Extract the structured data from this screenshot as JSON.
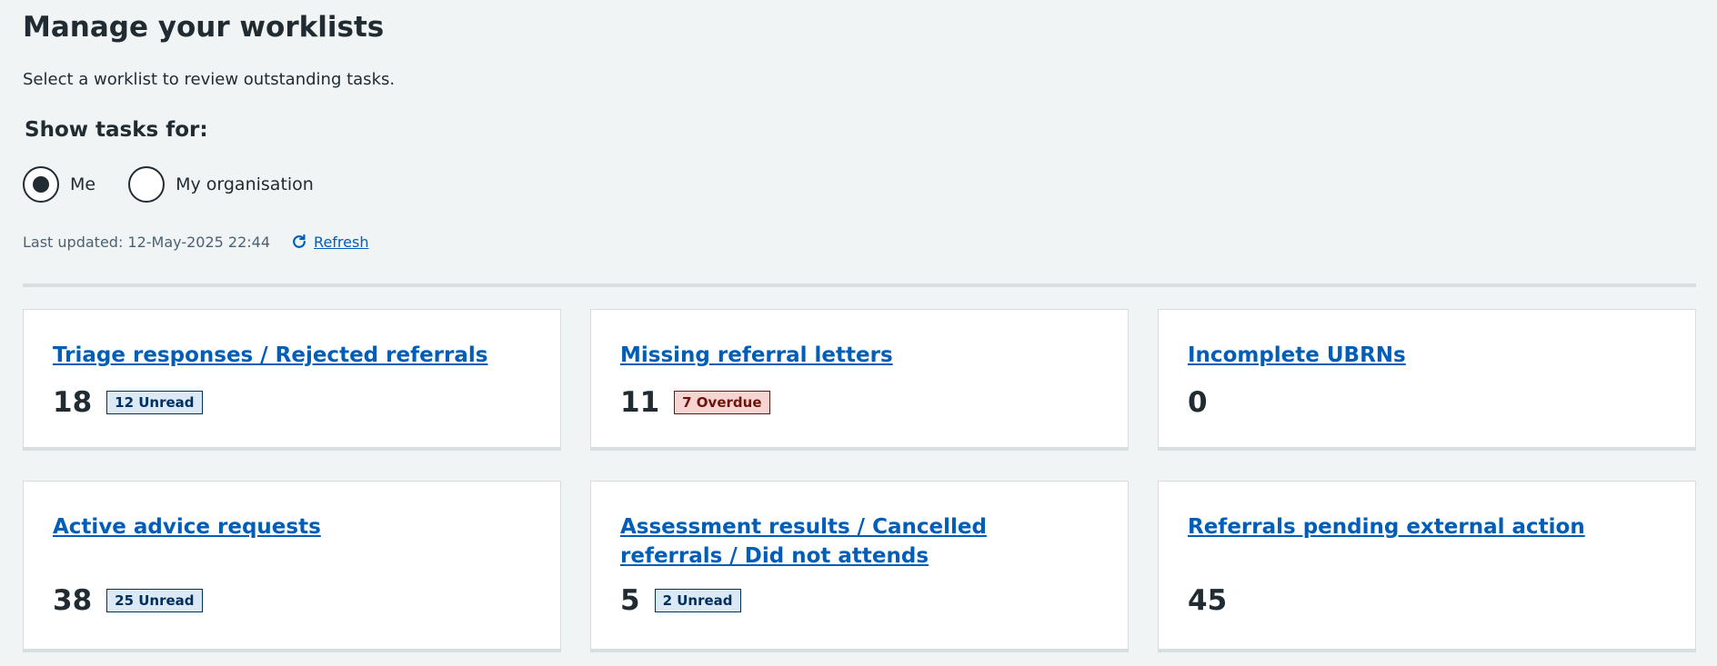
{
  "page": {
    "title": "Manage your worklists",
    "intro": "Select a worklist to review outstanding tasks.",
    "show_tasks_label": "Show tasks for:",
    "radios": [
      {
        "label": "Me",
        "checked": true
      },
      {
        "label": "My organisation",
        "checked": false
      }
    ],
    "last_updated": "Last updated: 12-May-2025 22:44",
    "refresh_label": "Refresh"
  },
  "cards": [
    {
      "title": "Triage responses / Rejected referrals",
      "count": "18",
      "tag": "12 Unread",
      "tag_style": "blue"
    },
    {
      "title": "Missing referral letters",
      "count": "11",
      "tag": "7 Overdue",
      "tag_style": "red"
    },
    {
      "title": "Incomplete UBRNs",
      "count": "0",
      "tag": "",
      "tag_style": ""
    },
    {
      "title": "Active advice requests",
      "count": "38",
      "tag": "25 Unread",
      "tag_style": "blue"
    },
    {
      "title": "Assessment results / Cancelled referrals / Did not attends",
      "count": "5",
      "tag": "2 Unread",
      "tag_style": "blue"
    },
    {
      "title": "Referrals pending external action",
      "count": "45",
      "tag": "",
      "tag_style": ""
    }
  ],
  "colors": {
    "link": "#005eb8",
    "background": "#f0f4f5",
    "text": "#212b32",
    "tag_blue_bg": "#dbe8f6",
    "tag_red_bg": "#f7d4d1"
  },
  "icons": {
    "refresh": "refresh-icon"
  }
}
